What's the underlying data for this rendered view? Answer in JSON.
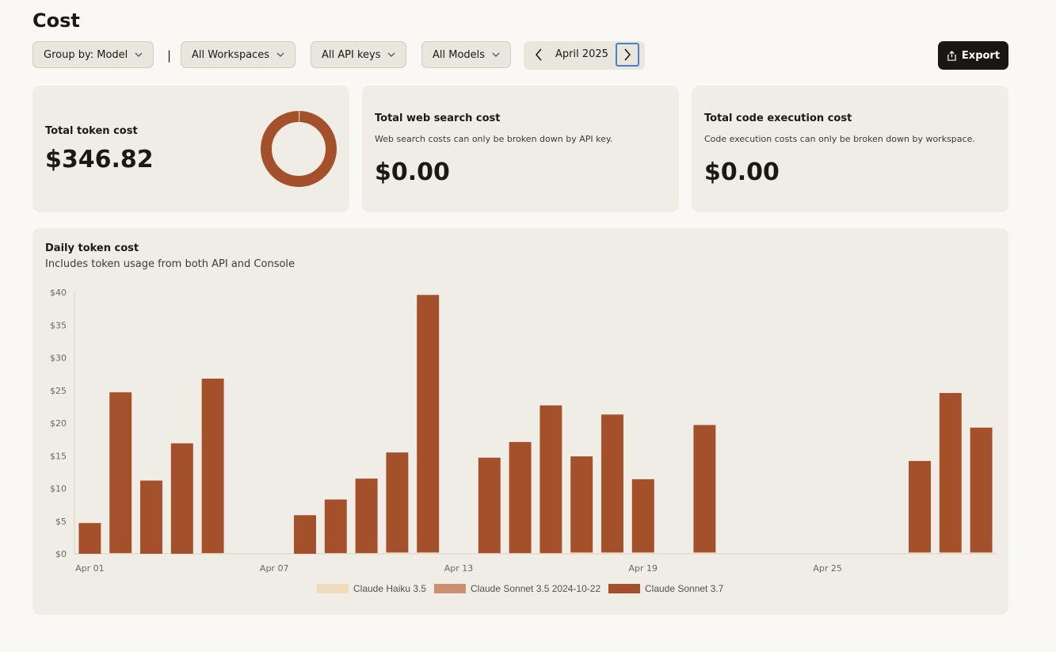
{
  "page": {
    "title": "Cost"
  },
  "toolbar": {
    "group_by": "Group by: Model",
    "separator": "|",
    "workspaces": "All Workspaces",
    "api_keys": "All API keys",
    "models": "All Models",
    "month": "April 2025",
    "export": "Export"
  },
  "cards": {
    "token": {
      "title": "Total token cost",
      "value": "$346.82"
    },
    "web_search": {
      "title": "Total web search cost",
      "note": "Web search costs can only be broken down by API key.",
      "value": "$0.00"
    },
    "code_exec": {
      "title": "Total code execution cost",
      "note": "Code execution costs can only be broken down by workspace.",
      "value": "$0.00"
    }
  },
  "donut": {
    "shares": [
      0.003,
      0.002,
      0.995
    ],
    "colors": [
      "#efdcbc",
      "#cc9070",
      "#a3502b"
    ]
  },
  "daily": {
    "title": "Daily token cost",
    "subtitle": "Includes token usage from both API and Console"
  },
  "chart_data": {
    "type": "bar",
    "stacked": true,
    "ylim": [
      0,
      40
    ],
    "yticks": [
      "$0",
      "$5",
      "$10",
      "$15",
      "$20",
      "$25",
      "$30",
      "$35",
      "$40"
    ],
    "xticks": [
      "Apr 01",
      "Apr 07",
      "Apr 13",
      "Apr 19",
      "Apr 25"
    ],
    "categories": [
      "Apr 01",
      "Apr 02",
      "Apr 03",
      "Apr 04",
      "Apr 05",
      "Apr 06",
      "Apr 07",
      "Apr 08",
      "Apr 09",
      "Apr 10",
      "Apr 11",
      "Apr 12",
      "Apr 13",
      "Apr 14",
      "Apr 15",
      "Apr 16",
      "Apr 17",
      "Apr 18",
      "Apr 19",
      "Apr 20",
      "Apr 21",
      "Apr 22",
      "Apr 23",
      "Apr 24",
      "Apr 25",
      "Apr 26",
      "Apr 27",
      "Apr 28",
      "Apr 29",
      "Apr 30"
    ],
    "series": [
      {
        "name": "Claude Haiku 3.5",
        "color": "#efdcbc",
        "values": [
          0,
          0.1,
          0,
          0,
          0.1,
          0,
          0,
          0,
          0.1,
          0.1,
          0.2,
          0.2,
          0,
          0.1,
          0.1,
          0.1,
          0.2,
          0.2,
          0.2,
          0,
          0.2,
          0,
          0,
          0,
          0,
          0,
          0,
          0.2,
          0.2,
          0.2
        ]
      },
      {
        "name": "Claude Sonnet 3.5 2024-10-22",
        "color": "#cc9070",
        "values": [
          0,
          0,
          0,
          0,
          0,
          0,
          0,
          0,
          0,
          0,
          0,
          0,
          0,
          0,
          0,
          0,
          0,
          0,
          0,
          0,
          0,
          0,
          0,
          0,
          0,
          0,
          0,
          0,
          0,
          0
        ]
      },
      {
        "name": "Claude Sonnet 3.7",
        "color": "#a3502b",
        "values": [
          4.7,
          24.6,
          11.2,
          16.9,
          26.7,
          0,
          0,
          5.9,
          8.2,
          11.4,
          15.3,
          39.4,
          0,
          14.6,
          17.0,
          22.6,
          14.7,
          21.1,
          11.2,
          0,
          19.5,
          0,
          0,
          0,
          0,
          0,
          0,
          14.0,
          24.4,
          19.1
        ]
      }
    ]
  }
}
